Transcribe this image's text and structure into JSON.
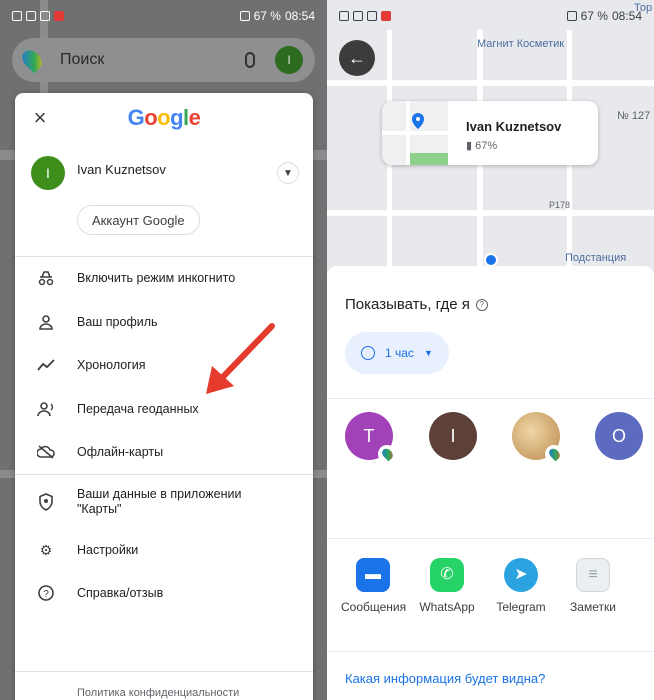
{
  "status_bar": {
    "battery": "67 %",
    "time": "08:54"
  },
  "left": {
    "search_placeholder": "Поиск",
    "avatar_initial": "I",
    "google_logo": [
      "G",
      "o",
      "o",
      "g",
      "l",
      "e"
    ],
    "account": {
      "name": "Ivan Kuznetsov",
      "initial": "I",
      "manage_button": "Аккаунт Google"
    },
    "menu": [
      {
        "label": "Включить режим инкогнито",
        "icon": "incognito-icon"
      },
      {
        "label": "Ваш профиль",
        "icon": "person-icon"
      },
      {
        "label": "Хронология",
        "icon": "timeline-icon"
      },
      {
        "label": "Передача геоданных",
        "icon": "location-sharing-icon"
      },
      {
        "label": "Офлайн-карты",
        "icon": "offline-maps-icon"
      },
      {
        "label": "Ваши данные в приложении \"Карты\"",
        "icon": "shield-icon"
      },
      {
        "label": "Настройки",
        "icon": "gear-icon"
      },
      {
        "label": "Справка/отзыв",
        "icon": "help-icon"
      }
    ],
    "footer": "Политика конфиденциальности",
    "annotation_color": "#e53b2c"
  },
  "right": {
    "map_labels": [
      "Магнит Косметик",
      "Подстанция",
      "№ 127",
      "P178",
      "Тор"
    ],
    "location_card": {
      "name": "Ivan Kuznetsov",
      "battery": "67%"
    },
    "sheet": {
      "title": "Показывать, где я",
      "duration": "1 час",
      "contacts": [
        {
          "initial": "T",
          "color": "#a142b8"
        },
        {
          "initial": "I",
          "color": "#5d4037"
        },
        {
          "initial": "",
          "color": "#c9a36a"
        },
        {
          "initial": "O",
          "color": "#5c6bc0"
        }
      ],
      "apps": [
        {
          "label": "Сообщения",
          "icon": "messages-icon",
          "color": "#1a73e8"
        },
        {
          "label": "WhatsApp",
          "icon": "whatsapp-icon",
          "color": "#25d366"
        },
        {
          "label": "Telegram",
          "icon": "telegram-icon",
          "color": "#2aa3e0"
        },
        {
          "label": "Заметки",
          "icon": "notes-icon",
          "color": "#e8eaed"
        }
      ],
      "info_link": "Какая информация будет видна?"
    }
  }
}
